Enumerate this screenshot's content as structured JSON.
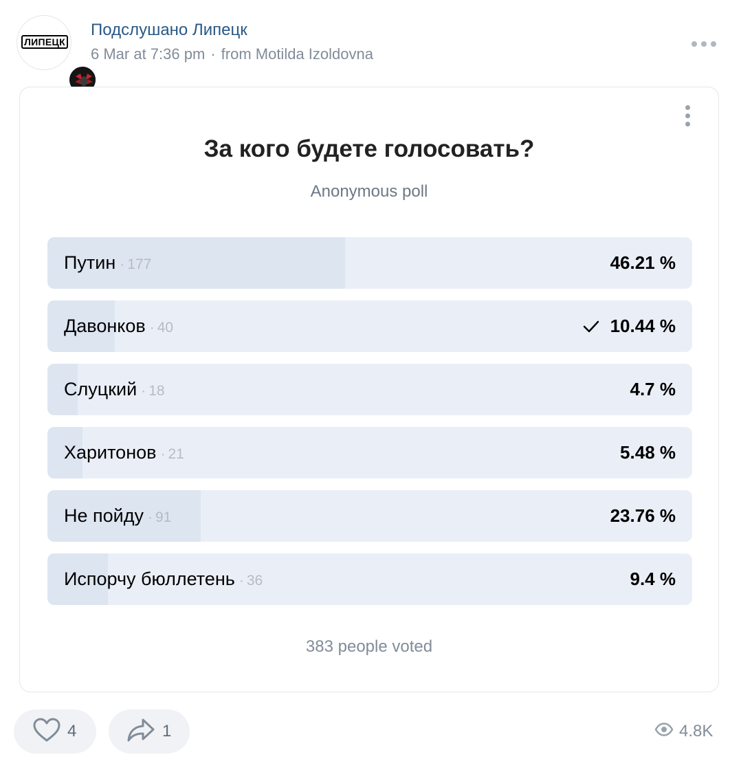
{
  "header": {
    "avatar_text": "ЛИПЕЦК",
    "author": "Подслушано Липецк",
    "date": "6 Mar at 7:36 pm",
    "separator": "·",
    "source": "from Motilda Izoldovna"
  },
  "poll": {
    "title": "За кого будете голосовать?",
    "subtitle": "Anonymous poll",
    "options": [
      {
        "label": "Путин",
        "count": "177",
        "percent_label": "46.21 %",
        "percent": 46.21,
        "voted": false
      },
      {
        "label": "Давонков",
        "count": "40",
        "percent_label": "10.44 %",
        "percent": 10.44,
        "voted": true
      },
      {
        "label": "Слуцкий",
        "count": "18",
        "percent_label": "4.7 %",
        "percent": 4.7,
        "voted": false
      },
      {
        "label": "Харитонов",
        "count": "21",
        "percent_label": "5.48 %",
        "percent": 5.48,
        "voted": false
      },
      {
        "label": "Не пойду",
        "count": "91",
        "percent_label": "23.76 %",
        "percent": 23.76,
        "voted": false
      },
      {
        "label": "Испорчу бюллетень",
        "count": "36",
        "percent_label": "9.4 %",
        "percent": 9.4,
        "voted": false
      }
    ],
    "footer": "383 people voted"
  },
  "actions": {
    "likes": "4",
    "shares": "1",
    "views": "4.8K"
  },
  "colors": {
    "link": "#2a5885",
    "secondary_text": "#818c99",
    "option_bg": "#eaeff7",
    "option_fill": "#dde5f1"
  }
}
